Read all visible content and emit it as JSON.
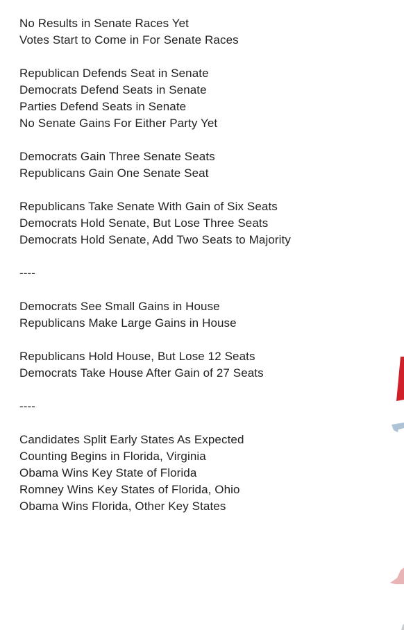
{
  "sections": [
    {
      "groups": [
        [
          "No Results in Senate Races Yet",
          "Votes Start to Come in For Senate Races"
        ],
        [
          "Republican Defends Seat in Senate",
          "Democrats Defend Seats in Senate",
          "Parties Defend Seats in Senate",
          "No Senate Gains For Either Party Yet"
        ],
        [
          "Democrats Gain Three Senate Seats",
          "Republicans Gain One Senate Seat"
        ],
        [
          "Republicans Take Senate With Gain of Six Seats",
          "Democrats Hold Senate, But Lose Three Seats",
          "Democrats Hold Senate, Add Two Seats to Majority"
        ]
      ]
    },
    {
      "groups": [
        [
          "Democrats See Small Gains in House",
          "Republicans Make Large Gains in House"
        ],
        [
          "Republicans Hold House, But Lose 12 Seats",
          "Democrats Take House After Gain of 27 Seats"
        ]
      ]
    },
    {
      "groups": [
        [
          "Candidates Split Early States As Expected",
          "Counting Begins in Florida, Virginia",
          "Obama Wins Key State of Florida",
          "Romney Wins Key States of Florida, Ohio",
          "Obama Wins Florida, Other Key States"
        ]
      ]
    }
  ],
  "separator": "----",
  "colors": {
    "text": "#222222",
    "red_accent": "#d0202a",
    "blue_accent": "#aec3d6",
    "pink_accent": "#e8b4b6"
  }
}
